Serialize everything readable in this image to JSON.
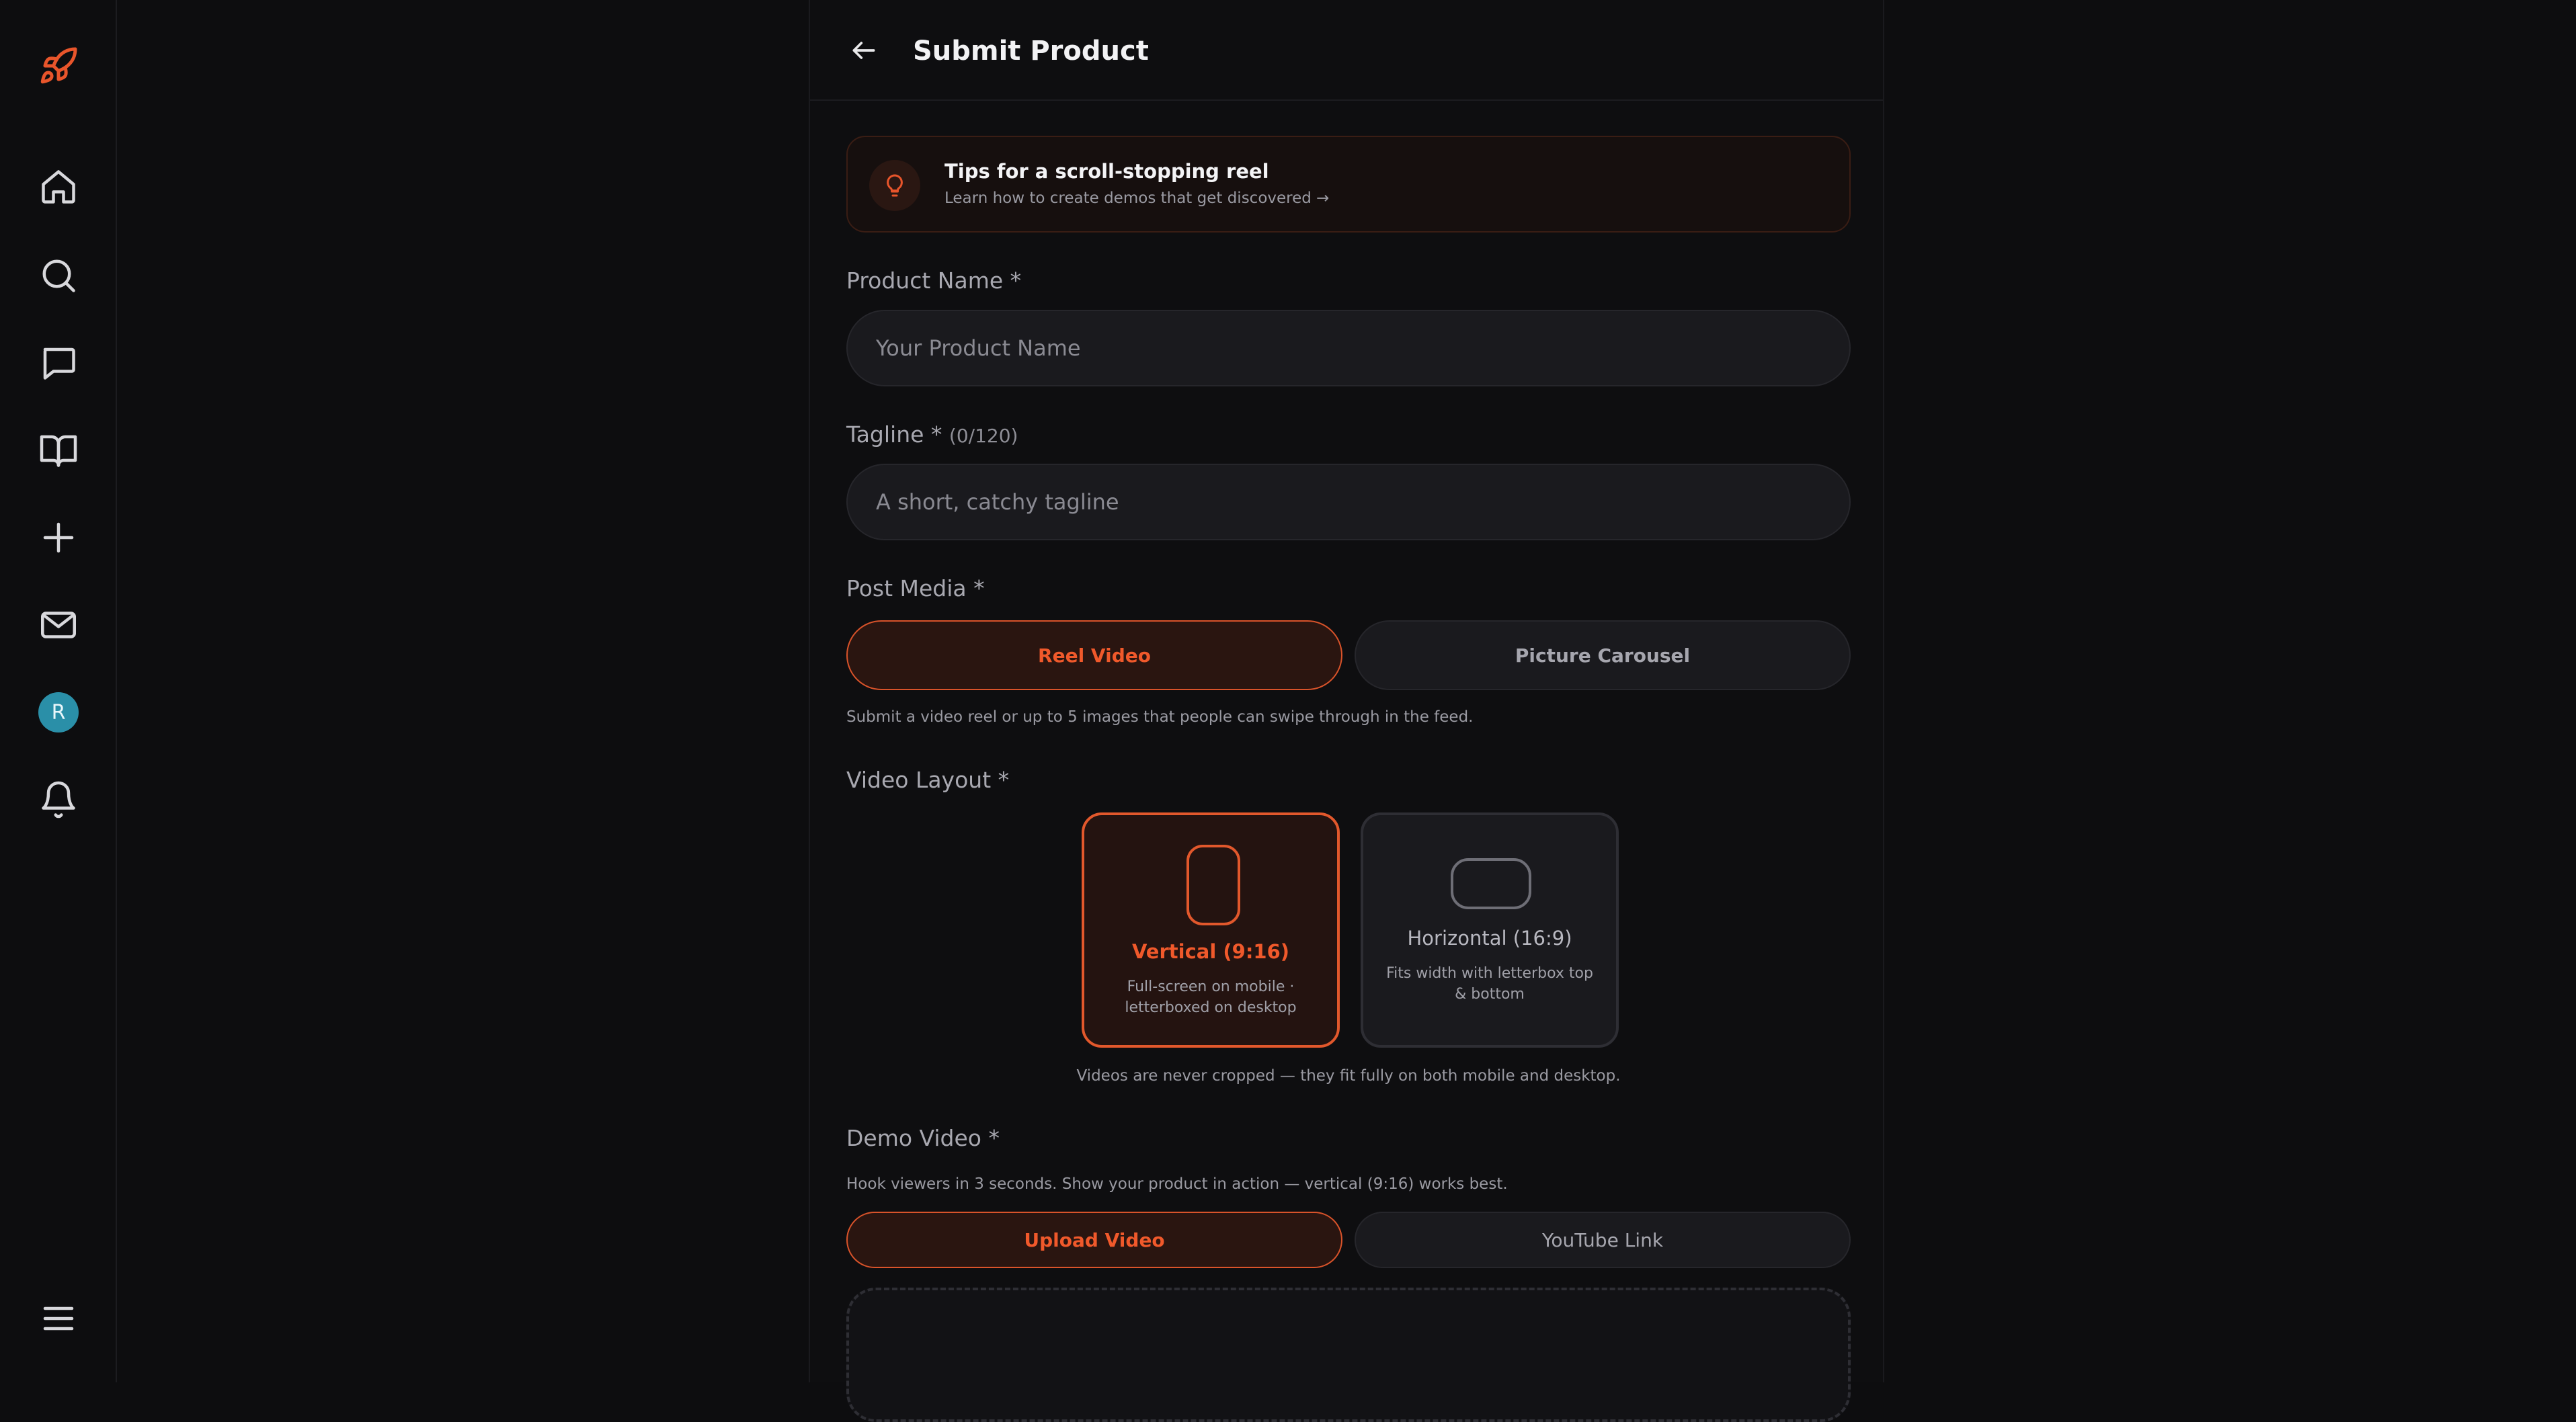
{
  "sidebar": {
    "items": [
      {
        "name": "logo",
        "icon": "rocket-icon"
      },
      {
        "name": "home",
        "icon": "home-icon"
      },
      {
        "name": "search",
        "icon": "search-icon"
      },
      {
        "name": "messages",
        "icon": "chat-icon"
      },
      {
        "name": "guides",
        "icon": "book-icon"
      },
      {
        "name": "create",
        "icon": "plus-icon"
      },
      {
        "name": "inbox",
        "icon": "mail-icon"
      },
      {
        "name": "profile",
        "icon": "avatar"
      },
      {
        "name": "notifications",
        "icon": "bell-icon"
      },
      {
        "name": "menu",
        "icon": "menu-icon"
      }
    ],
    "avatar_initial": "R",
    "accent": "#e8552b"
  },
  "header": {
    "title": "Submit Product"
  },
  "tips": {
    "title": "Tips for a scroll-stopping reel",
    "subtitle": "Learn how to create demos that get discovered →"
  },
  "form": {
    "product_name": {
      "label": "Product Name *",
      "placeholder": "Your Product Name",
      "value": ""
    },
    "tagline": {
      "label": "Tagline *",
      "counter": "(0/120)",
      "placeholder": "A short, catchy tagline",
      "value": ""
    },
    "post_media": {
      "label": "Post Media *",
      "options": [
        "Reel Video",
        "Picture Carousel"
      ],
      "selected": "Reel Video",
      "helper": "Submit a video reel or up to 5 images that people can swipe through in the feed."
    },
    "video_layout": {
      "label": "Video Layout *",
      "options": [
        {
          "title": "Vertical (9:16)",
          "desc": "Full-screen on mobile · letterboxed on desktop",
          "selected": true
        },
        {
          "title": "Horizontal (16:9)",
          "desc": "Fits width with letterbox top & bottom",
          "selected": false
        }
      ],
      "helper": "Videos are never cropped — they fit fully on both mobile and desktop."
    },
    "demo_video": {
      "label": "Demo Video *",
      "helper": "Hook viewers in 3 seconds. Show your product in action — vertical (9:16) works best.",
      "options": [
        "Upload Video",
        "YouTube Link"
      ],
      "selected": "Upload Video"
    }
  },
  "colors": {
    "accent": "#f0592b",
    "background": "#0d0d0f",
    "surface": "#1a1a1e"
  }
}
